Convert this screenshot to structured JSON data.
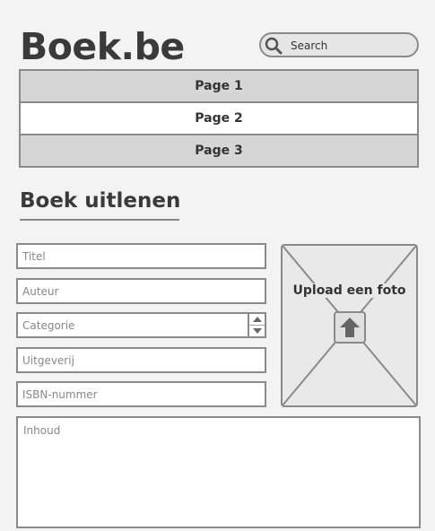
{
  "header": {
    "logo": "Boek.be",
    "search_placeholder": "Search"
  },
  "nav": {
    "items": [
      {
        "label": "Page 1"
      },
      {
        "label": "Page 2"
      },
      {
        "label": "Page 3"
      }
    ],
    "active_label": "Page 2"
  },
  "main": {
    "title": "Boek uitlenen"
  },
  "form": {
    "title_placeholder": "Titel",
    "author_placeholder": "Auteur",
    "category_placeholder": "Categorie",
    "publisher_placeholder": "Uitgeverij",
    "isbn_placeholder": "ISBN-nummer",
    "content_placeholder": "Inhoud"
  },
  "upload": {
    "label": "Upload een foto",
    "icon": "upload-arrow-icon"
  },
  "icons": {
    "search": "search-icon",
    "stepper_up": "chevron-up-icon",
    "stepper_down": "chevron-down-icon"
  },
  "colors": {
    "background": "#f3f3f3",
    "border": "#8a8a8a",
    "nav_inactive": "#d6d6d6",
    "nav_active": "#ffffff",
    "text": "#333333"
  }
}
